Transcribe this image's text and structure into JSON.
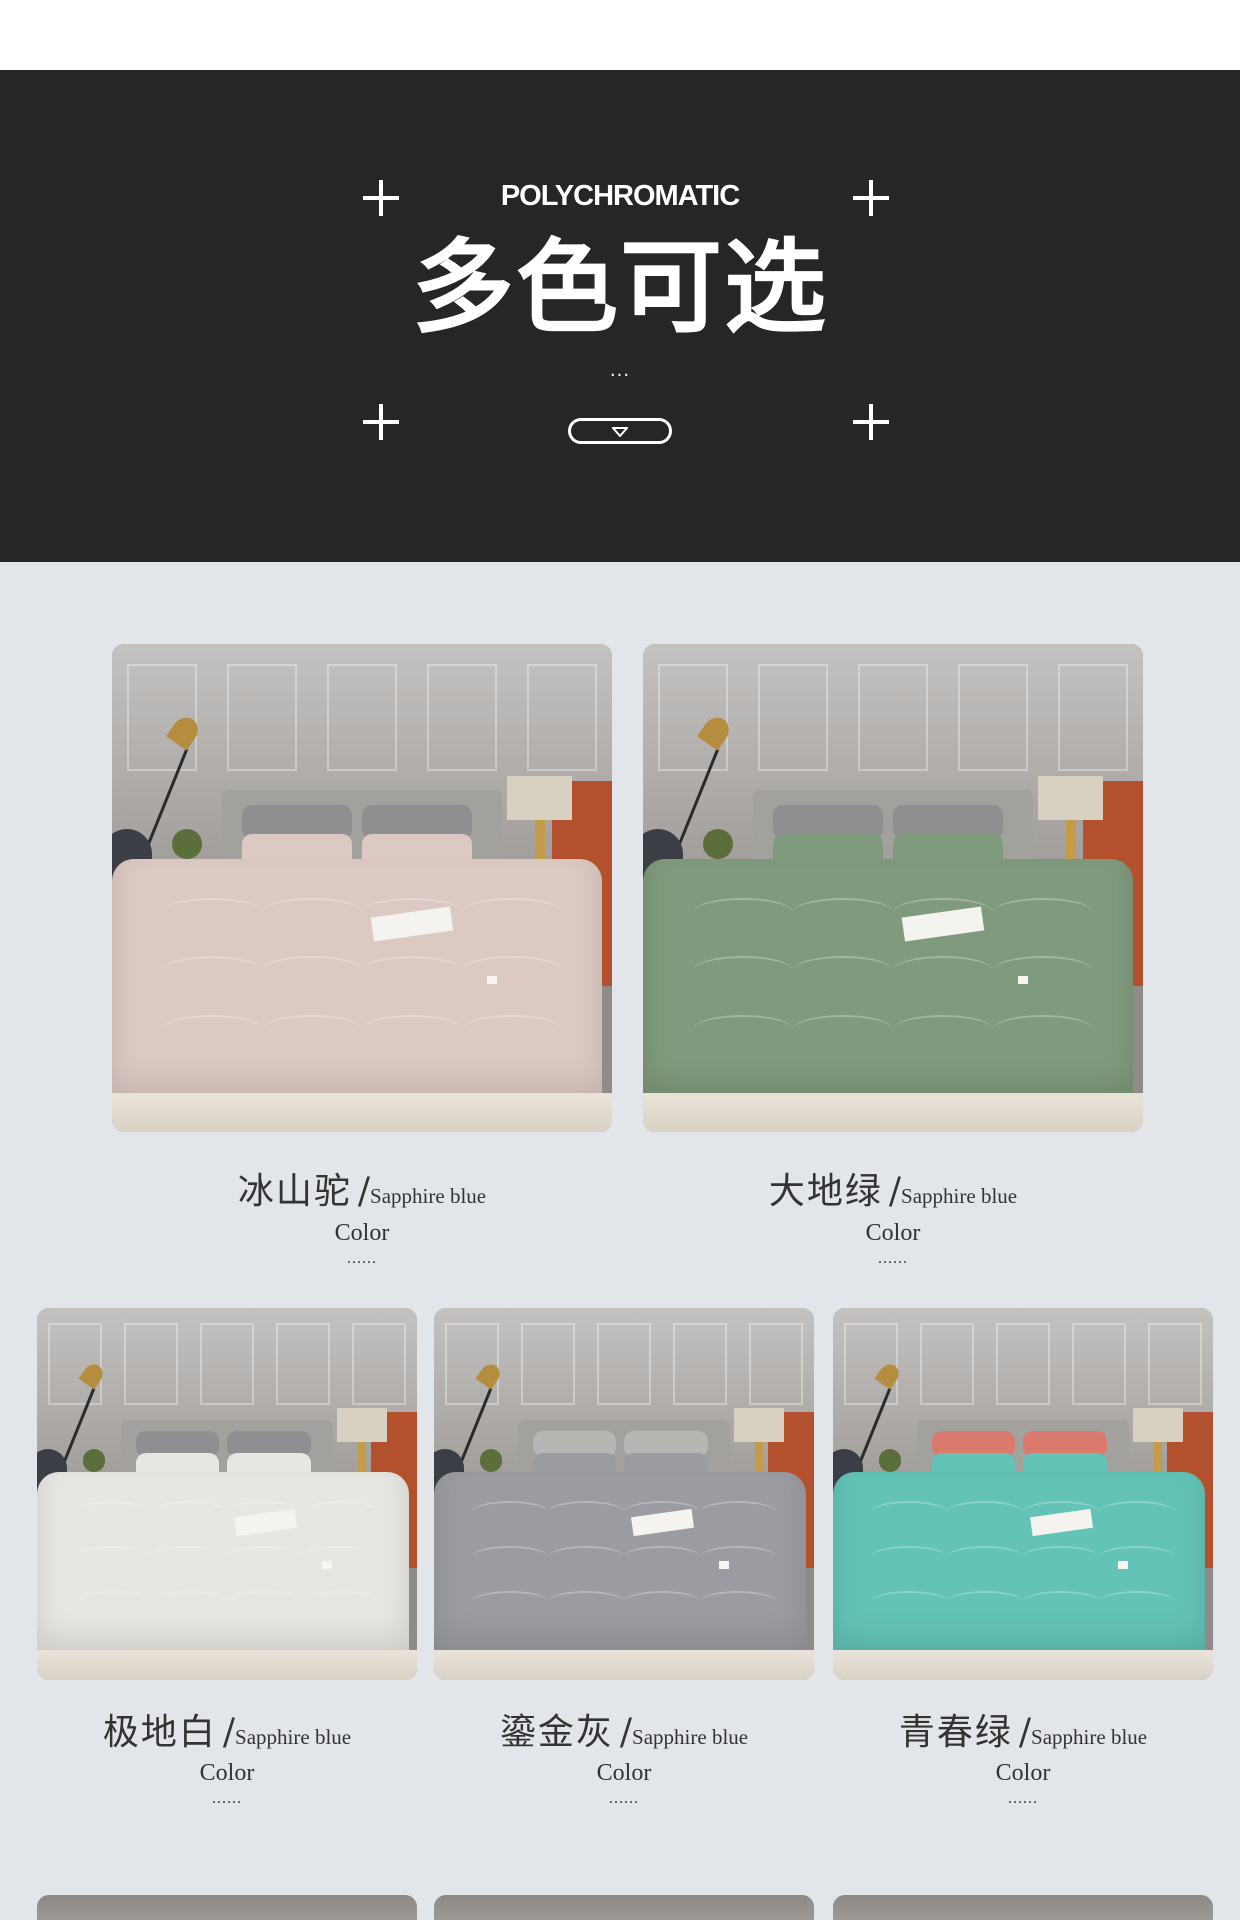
{
  "banner": {
    "subtitle": "POLYCHROMATIC",
    "title": "多色可选",
    "dots": "...",
    "icon": "chevron-down-icon"
  },
  "products": [
    {
      "name": "冰山驼",
      "slash": "/",
      "en": "Sapphire blue",
      "color_label": "Color",
      "dots": "......",
      "duvet_color": "#dcc9c4",
      "accent_color": "#8f8e90"
    },
    {
      "name": "大地绿",
      "slash": "/",
      "en": "Sapphire blue",
      "color_label": "Color",
      "dots": "......",
      "duvet_color": "#7f9a7c",
      "accent_color": "#8f8e90"
    },
    {
      "name": "极地白",
      "slash": "/",
      "en": "Sapphire blue",
      "color_label": "Color",
      "dots": "......",
      "duvet_color": "#e8e6e1",
      "accent_color": "#8f8e90"
    },
    {
      "name": "鎏金灰",
      "slash": "/",
      "en": "Sapphire blue",
      "color_label": "Color",
      "dots": "......",
      "duvet_color": "#9b9ca1",
      "accent_color": "#b7b6b4"
    },
    {
      "name": "青春绿",
      "slash": "/",
      "en": "Sapphire blue",
      "color_label": "Color",
      "dots": "......",
      "duvet_color": "#63c3b7",
      "accent_color": "#d97a6d"
    }
  ],
  "colors": {
    "banner_bg": "#262626",
    "gallery_bg": "#e2e5ea",
    "text": "#333333"
  }
}
